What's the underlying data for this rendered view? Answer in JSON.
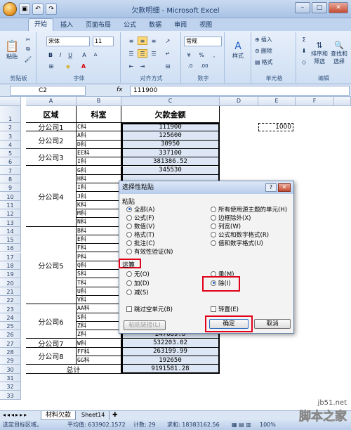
{
  "window": {
    "title": "欠款明细 - Microsoft Excel"
  },
  "tabs": [
    "开始",
    "插入",
    "页面布局",
    "公式",
    "数据",
    "审阅",
    "视图"
  ],
  "ribbon": {
    "clipboard": {
      "paste": "粘贴",
      "label": "剪贴板"
    },
    "font": {
      "name": "宋体",
      "size": "11",
      "label": "字体"
    },
    "alignment": {
      "label": "对齐方式"
    },
    "number": {
      "format": "常规",
      "label": "数字"
    },
    "styles": {
      "label": "样式"
    },
    "cells": {
      "insert": "插入",
      "delete": "删除",
      "format": "格式",
      "label": "单元格"
    },
    "editing": {
      "sort": "排序和",
      "sort2": "筛选",
      "find": "查找和",
      "find2": "选择",
      "label": "编辑"
    }
  },
  "formula_bar": {
    "name_box": "C2",
    "fx": "fx",
    "value": "111900"
  },
  "columns": [
    "A",
    "B",
    "C",
    "D",
    "E",
    "F"
  ],
  "sheet": {
    "header": {
      "a": "区域",
      "b": "科室",
      "c": "欠款金额"
    },
    "b_col": [
      "C科",
      "A科",
      "D科",
      "EE科",
      "I科",
      "G科",
      "H科",
      "I科",
      "J科",
      "K科",
      "M科",
      "N科",
      "B科",
      "E科",
      "F科",
      "P科",
      "Q科",
      "S科",
      "T科",
      "U科",
      "V科",
      "AA科",
      "S科",
      "Z科",
      "Z科",
      "W科",
      "FF科",
      "GG科"
    ],
    "c_col": {
      "2": "111900",
      "3": "125600",
      "4": "30950",
      "5": "337100",
      "6": "381386.52",
      "7": "345530",
      "25": "401015.7",
      "26": "247689.8",
      "27": "532203.02",
      "28": "263199.99",
      "29": "192650",
      "30": "9191581.28"
    },
    "groups": [
      {
        "label": "分公司1"
      },
      {
        "label": "分公司2"
      },
      {
        "label": "分公司3"
      },
      {
        "label": "分公司4"
      },
      {
        "label": "分公司5"
      },
      {
        "label": "分公司6"
      },
      {
        "label": "分公司7"
      },
      {
        "label": "分公司8"
      }
    ],
    "total_label": "总计",
    "e2_value": "1000"
  },
  "dialog": {
    "title": "选择性粘贴",
    "paste_label": "粘贴",
    "paste_left": [
      "全部(A)",
      "公式(F)",
      "数值(V)",
      "格式(T)",
      "批注(C)",
      "有效性验证(N)"
    ],
    "paste_right": [
      "所有使用源主题的单元(H)",
      "边框除外(X)",
      "列宽(W)",
      "公式和数字格式(R)",
      "值和数字格式(U)"
    ],
    "op_label": "运算",
    "op_left": [
      "无(O)",
      "加(D)",
      "减(S)"
    ],
    "op_right": [
      "乘(M)",
      "除(I)"
    ],
    "skip_blanks": "跳过空单元(B)",
    "transpose": "转置(E)",
    "paste_link": "粘贴链接(L)",
    "ok": "确定",
    "cancel": "取消"
  },
  "sheet_tabs": [
    "材料欠款",
    "Sheet14"
  ],
  "status": {
    "mode": "选定目标区域，",
    "average": "平均值: 633902.1572",
    "count": "计数: 29",
    "sum": "求和: 18383162.56",
    "zoom": "100%"
  },
  "watermark": {
    "line1": "jb51.net",
    "line2": "脚本之家"
  }
}
